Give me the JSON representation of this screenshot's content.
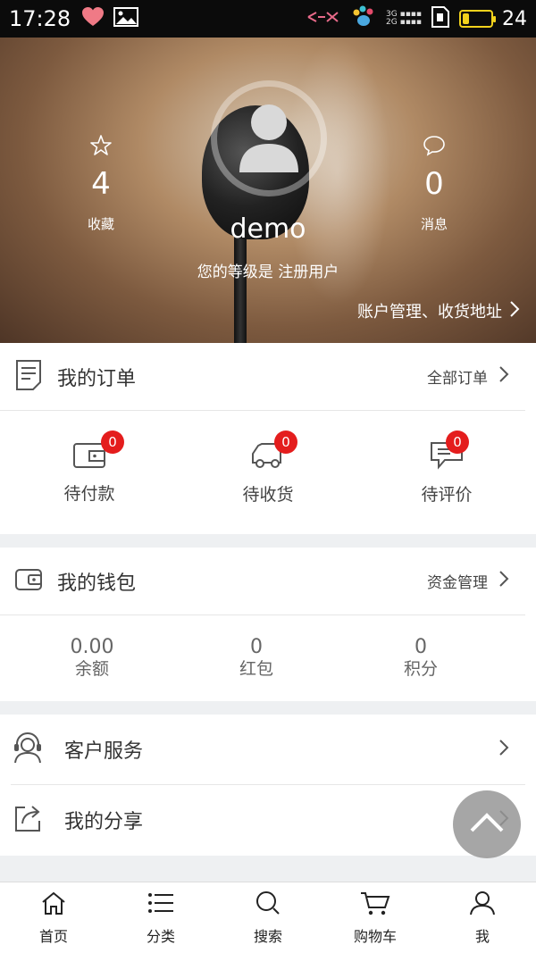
{
  "status_bar": {
    "time": "17:28",
    "battery_level": "24",
    "battery_fill_fraction": 0.24,
    "network_3g": "3G",
    "network_2g": "2G"
  },
  "profile": {
    "username": "demo",
    "level_text": "您的等级是 注册用户",
    "favorites_count": "4",
    "favorites_label": "收藏",
    "messages_count": "0",
    "messages_label": "消息",
    "account_link": "账户管理、收货地址"
  },
  "orders": {
    "title": "我的订单",
    "all_link": "全部订单",
    "items": [
      {
        "label": "待付款",
        "badge": "0",
        "icon": "wallet-card-icon"
      },
      {
        "label": "待收货",
        "badge": "0",
        "icon": "delivery-truck-icon"
      },
      {
        "label": "待评价",
        "badge": "0",
        "icon": "comment-icon"
      }
    ]
  },
  "wallet": {
    "title": "我的钱包",
    "manage_link": "资金管理",
    "items": [
      {
        "value": "0.00",
        "label": "余额"
      },
      {
        "value": "0",
        "label": "红包"
      },
      {
        "value": "0",
        "label": "积分"
      }
    ]
  },
  "services": {
    "customer_service": "客户服务",
    "my_share": "我的分享"
  },
  "tabbar": {
    "items": [
      {
        "label": "首页",
        "icon": "home-icon"
      },
      {
        "label": "分类",
        "icon": "list-icon"
      },
      {
        "label": "搜索",
        "icon": "search-icon"
      },
      {
        "label": "购物车",
        "icon": "cart-icon"
      },
      {
        "label": "我",
        "icon": "user-icon"
      }
    ]
  },
  "colors": {
    "badge": "#e41d1d",
    "battery": "#f2d21c",
    "background": "#eef0f2"
  }
}
